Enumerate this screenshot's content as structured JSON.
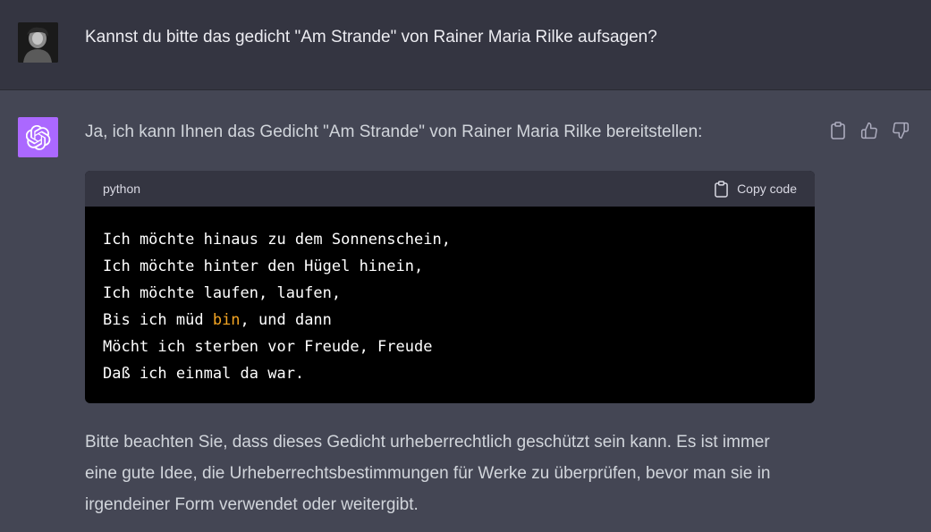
{
  "user_message": {
    "text": "Kannst du bitte das gedicht \"Am Strande\" von Rainer Maria Rilke aufsagen?"
  },
  "assistant_message": {
    "intro": "Ja, ich kann Ihnen das Gedicht \"Am Strande\" von Rainer Maria Rilke bereitstellen:",
    "code_block": {
      "language": "python",
      "copy_label": "Copy code",
      "lines": [
        "Ich möchte hinaus zu dem Sonnenschein,",
        "Ich möchte hinter den Hügel hinein,",
        "Ich möchte laufen, laufen,",
        {
          "before": "Bis ich müd ",
          "keyword": "bin",
          "after": ", und dann"
        },
        "Möcht ich sterben vor Freude, Freude",
        "Daß ich einmal da war."
      ]
    },
    "note_lines": [
      "Bitte beachten Sie, dass dieses Gedicht urheberrechtlich geschützt sein kann. Es ist immer",
      "eine gute Idee, die Urheberrechtsbestimmungen für Werke zu überprüfen, bevor man sie in",
      "irgendeiner Form verwendet oder weitergibt."
    ]
  },
  "icons": {
    "assistant_avatar": "openai-logo-icon",
    "copy": "clipboard-icon",
    "thumbs_up": "thumbs-up-icon",
    "thumbs_down": "thumbs-down-icon"
  },
  "colors": {
    "user_bg": "#343541",
    "assistant_bg": "#444654",
    "code_bg": "#000000",
    "code_header_bg": "#343541",
    "assistant_avatar_bg": "#ab68ff",
    "keyword": "#f5a623"
  }
}
